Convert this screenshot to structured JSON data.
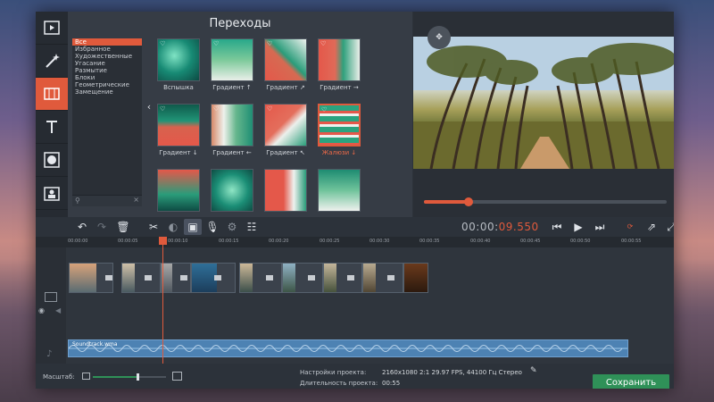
{
  "panel": {
    "title": "Переходы"
  },
  "categories": [
    "Все",
    "Избранное",
    "Художественные",
    "Угасание",
    "Размытие",
    "Блоки",
    "Геометрические",
    "Замещение"
  ],
  "transitions": [
    {
      "label": "Вспышка"
    },
    {
      "label": "Градиент ↑"
    },
    {
      "label": "Градиент ↗"
    },
    {
      "label": "Градиент →"
    },
    {
      "label": "Градиент ↓"
    },
    {
      "label": "Градиент ←"
    },
    {
      "label": "Градиент ↖"
    },
    {
      "label": "Жалюзи ↓"
    }
  ],
  "timecode": {
    "main": "00:00:",
    "accent": "09.550"
  },
  "ruler": [
    "00:00:00",
    "00:00:05",
    "00:00:10",
    "00:00:15",
    "00:00:20",
    "00:00:25",
    "00:00:30",
    "00:00:35",
    "00:00:40",
    "00:00:45",
    "00:00:50",
    "00:00:55"
  ],
  "audio": {
    "label": "Soundtrack.wma"
  },
  "footer": {
    "scale_label": "Масштаб:",
    "settings_label": "Настройки проекта:",
    "settings_value": "2160x1080 2:1 29.97 FPS, 44100 Гц Стерео",
    "duration_label": "Длительность проекта:",
    "duration_value": "00:55",
    "save": "Сохранить"
  },
  "scale": {
    "level": 0.6
  },
  "playback": {
    "progress": 0.18
  },
  "colors": {
    "accent": "#e05a3c",
    "save": "#2f9158",
    "audio": "#4d82b3"
  }
}
